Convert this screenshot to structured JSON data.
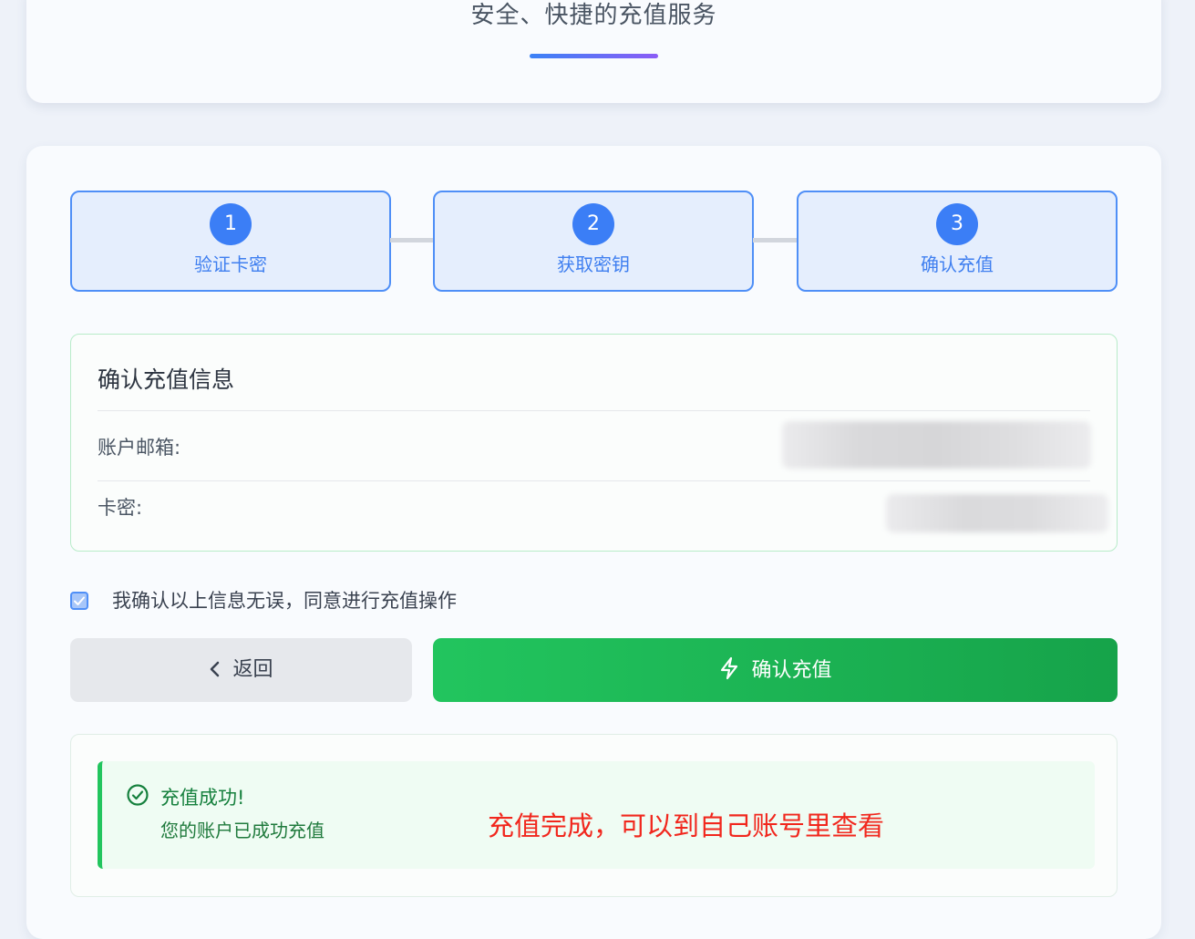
{
  "header": {
    "subtitle": "安全、快捷的充值服务"
  },
  "steps": [
    {
      "number": "1",
      "label": "验证卡密"
    },
    {
      "number": "2",
      "label": "获取密钥"
    },
    {
      "number": "3",
      "label": "确认充值"
    }
  ],
  "info": {
    "title": "确认充值信息",
    "email_label": "账户邮箱:",
    "card_label": "卡密:"
  },
  "agreement": {
    "checked": true,
    "text": "我确认以上信息无误，同意进行充值操作"
  },
  "buttons": {
    "back_label": "返回",
    "confirm_label": "确认充值"
  },
  "result": {
    "title": "充值成功!",
    "description": "您的账户已成功充值",
    "annotation": "充值完成，可以到自己账号里查看"
  },
  "colors": {
    "accent_blue": "#3b7ef6",
    "success_green": "#22c55e",
    "annotation_red": "#f1271d"
  }
}
